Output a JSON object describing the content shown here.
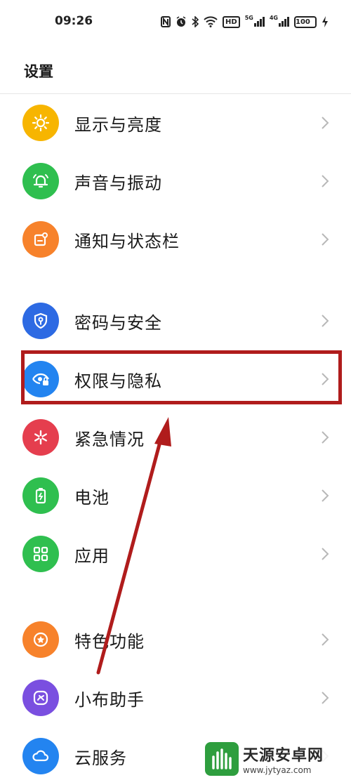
{
  "status": {
    "time": "09:26",
    "hd": "HD",
    "net1": "5G",
    "net2": "4G",
    "battery": "100"
  },
  "header": {
    "title": "设置"
  },
  "items": [
    {
      "label": "显示与亮度",
      "icon": "sun-icon",
      "color": "#f7b500"
    },
    {
      "label": "声音与振动",
      "icon": "bell-icon",
      "color": "#2fbf4f"
    },
    {
      "label": "通知与状态栏",
      "icon": "notification-icon",
      "color": "#f7822b"
    },
    {
      "label": "密码与安全",
      "icon": "shield-key-icon",
      "color": "#2d6ae3"
    },
    {
      "label": "权限与隐私",
      "icon": "eye-lock-icon",
      "color": "#2384f0"
    },
    {
      "label": "紧急情况",
      "icon": "asterisk-icon",
      "color": "#e53e4e"
    },
    {
      "label": "电池",
      "icon": "battery-icon",
      "color": "#2fbf4f"
    },
    {
      "label": "应用",
      "icon": "grid-icon",
      "color": "#2fbf4f"
    },
    {
      "label": "特色功能",
      "icon": "star-icon",
      "color": "#f7822b"
    },
    {
      "label": "小布助手",
      "icon": "assistant-icon",
      "color": "#7a4fe0"
    },
    {
      "label": "云服务",
      "icon": "cloud-icon",
      "color": "#2384f0"
    }
  ],
  "annotation": {
    "highlight_color": "#b01c1c",
    "highlighted_item": "权限与隐私"
  },
  "watermark": {
    "title": "天源安卓网",
    "url": "www.jytyaz.com"
  }
}
